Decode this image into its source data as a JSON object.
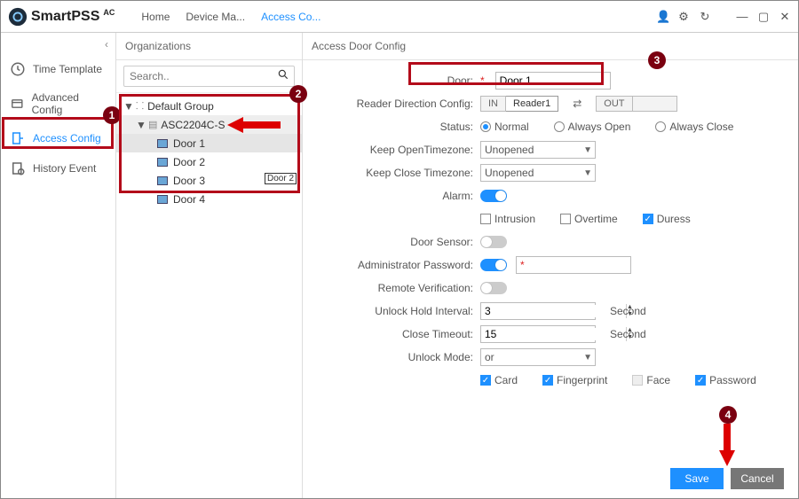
{
  "app": {
    "name": "SmartPSS",
    "suffix": "AC"
  },
  "tabs": {
    "home": "Home",
    "devmgr": "Device Ma...",
    "access": "Access Co..."
  },
  "nav": {
    "time_template": "Time Template",
    "advanced_config": "Advanced Config",
    "access_config": "Access Config",
    "history_event": "History Event"
  },
  "org": {
    "header": "Organizations",
    "search_placeholder": "Search..",
    "root": "Default Group",
    "device": "ASC2204C-S",
    "doors": [
      "Door 1",
      "Door 2",
      "Door 3",
      "Door 4"
    ],
    "tag_door2": "Door 2"
  },
  "cfg": {
    "header": "Access Door Config",
    "labels": {
      "door": "Door:",
      "direction": "Reader Direction Config:",
      "status": "Status:",
      "keep_open": "Keep OpenTimezone:",
      "keep_close": "Keep Close Timezone:",
      "alarm": "Alarm:",
      "intrusion": "Intrusion",
      "overtime": "Overtime",
      "duress": "Duress",
      "door_sensor": "Door Sensor:",
      "admin_pw": "Administrator Password:",
      "remote_verify": "Remote Verification:",
      "unlock_hold": "Unlock Hold Interval:",
      "close_timeout": "Close Timeout:",
      "unlock_mode": "Unlock Mode:",
      "card": "Card",
      "fingerprint": "Fingerprint",
      "face": "Face",
      "password": "Password",
      "second": "Second"
    },
    "values": {
      "door_name": "Door 1",
      "dir_in": "IN",
      "dir_reader": "Reader1",
      "dir_out": "OUT",
      "status_normal": "Normal",
      "status_open": "Always Open",
      "status_close": "Always Close",
      "keep_open": "Unopened",
      "keep_close": "Unopened",
      "admin_pw": "*",
      "unlock_hold": "3",
      "close_timeout": "15",
      "unlock_mode": "or"
    },
    "buttons": {
      "save": "Save",
      "cancel": "Cancel"
    }
  },
  "badges": {
    "b1": "1",
    "b2": "2",
    "b3": "3",
    "b4": "4"
  }
}
